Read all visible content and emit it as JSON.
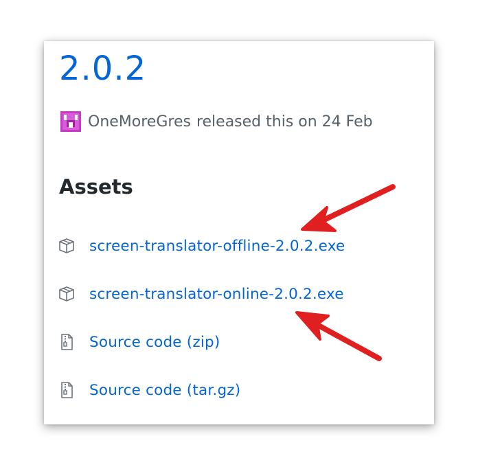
{
  "release": {
    "version": "2.0.2",
    "author": "OneMoreGres",
    "released_text": "released this on 24 Feb"
  },
  "assets": {
    "title": "Assets",
    "items": [
      {
        "label": "screen-translator-offline-2.0.2.exe",
        "icon": "package-icon"
      },
      {
        "label": "screen-translator-online-2.0.2.exe",
        "icon": "package-icon"
      },
      {
        "label": "Source code (zip)",
        "icon": "file-zip-icon"
      },
      {
        "label": "Source code (tar.gz)",
        "icon": "file-zip-icon"
      }
    ]
  },
  "colors": {
    "link": "#0366d6",
    "muted": "#586069",
    "heading": "#24292e",
    "arrow": "#e02020",
    "avatar": "#c43ac4"
  }
}
